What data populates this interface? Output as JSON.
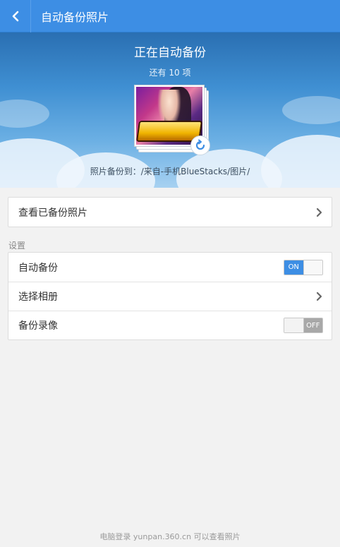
{
  "header": {
    "title": "自动备份照片",
    "back_icon": "chevron-left-icon"
  },
  "hero": {
    "status_title": "正在自动备份",
    "remaining": "还有 10 项",
    "destination": "照片备份到：/来自-手机BlueStacks/图片/",
    "sync_icon": "sync-icon"
  },
  "view_backup": {
    "label": "查看已备份照片",
    "icon": "chevron-right-icon"
  },
  "settings": {
    "section_label": "设置",
    "items": [
      {
        "label": "自动备份",
        "control": "toggle",
        "state": "ON"
      },
      {
        "label": "选择相册",
        "control": "chevron"
      },
      {
        "label": "备份录像",
        "control": "toggle",
        "state": "OFF"
      }
    ]
  },
  "footer": {
    "text": "电脑登录 yunpan.360.cn 可以查看照片"
  },
  "colors": {
    "accent": "#3d8ee4",
    "toggle_off": "#a8a8a8",
    "background": "#f2f2f2"
  }
}
